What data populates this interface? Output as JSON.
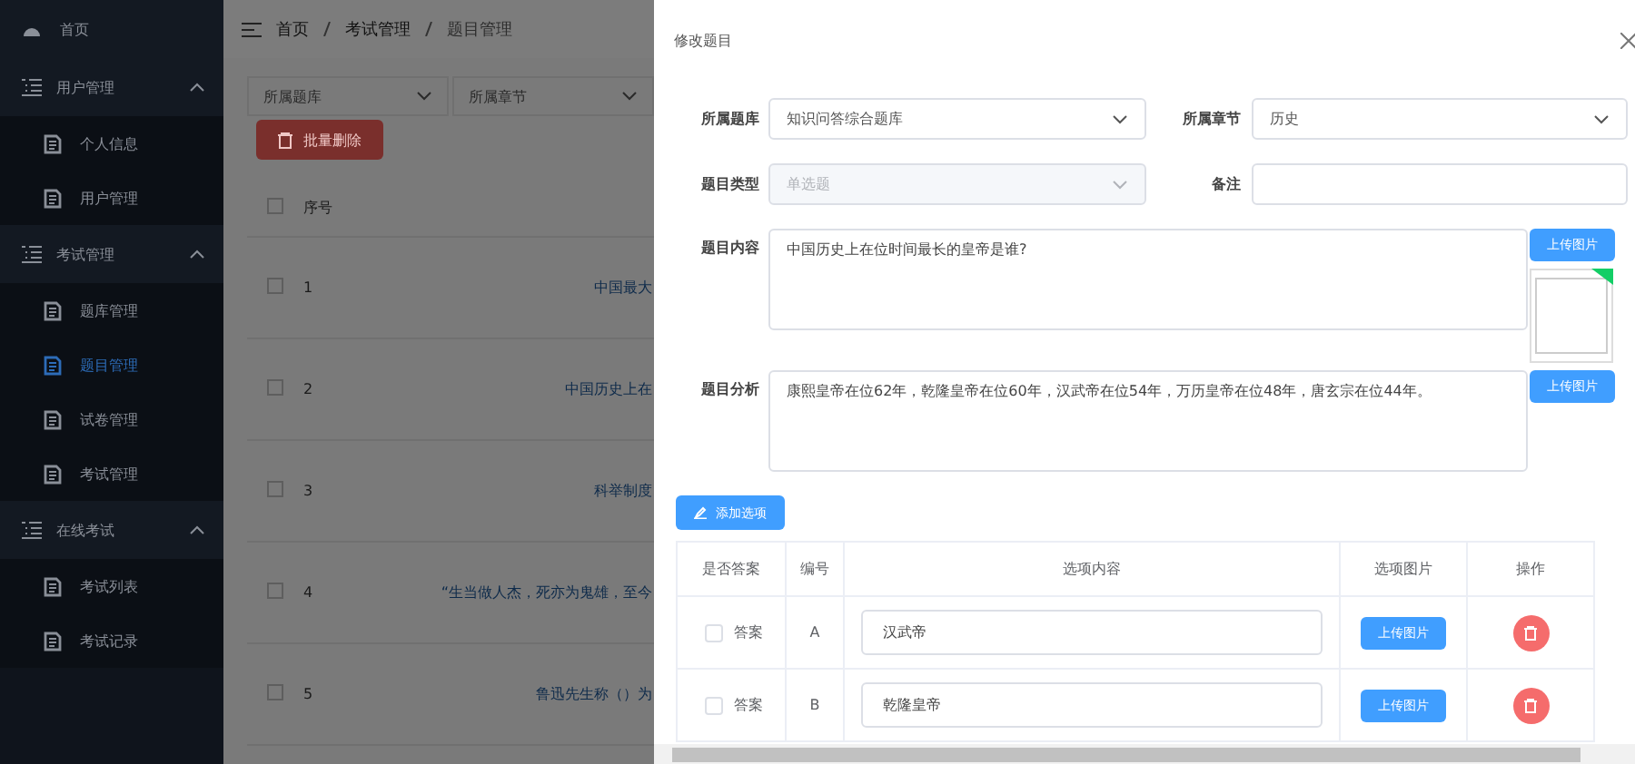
{
  "sidebar": {
    "items": [
      {
        "kind": "link",
        "label": "首页",
        "selected": false
      },
      {
        "kind": "group",
        "label": "用户管理",
        "expanded": true,
        "children": [
          {
            "label": "个人信息",
            "selected": false
          },
          {
            "label": "用户管理",
            "selected": false
          }
        ]
      },
      {
        "kind": "group",
        "label": "考试管理",
        "expanded": true,
        "children": [
          {
            "label": "题库管理",
            "selected": false
          },
          {
            "label": "题目管理",
            "selected": true
          },
          {
            "label": "试卷管理",
            "selected": false
          },
          {
            "label": "考试管理",
            "selected": false
          }
        ]
      },
      {
        "kind": "group",
        "label": "在线考试",
        "expanded": true,
        "children": [
          {
            "label": "考试列表",
            "selected": false
          },
          {
            "label": "考试记录",
            "selected": false
          }
        ]
      }
    ]
  },
  "breadcrumb": [
    "首页",
    "考试管理",
    "题目管理"
  ],
  "filters": [
    {
      "placeholder": "所属题库"
    },
    {
      "placeholder": "所属章节"
    }
  ],
  "batch_delete_button": "批量删除",
  "table": {
    "all_checked": false,
    "columns": [
      "序号"
    ],
    "rows": [
      {
        "checked": false,
        "index": "1",
        "question": "中国最大"
      },
      {
        "checked": false,
        "index": "2",
        "question": "中国历史上在"
      },
      {
        "checked": false,
        "index": "3",
        "question": "科举制度"
      },
      {
        "checked": false,
        "index": "4",
        "question": "“生当做人杰，死亦为鬼雄，至今"
      },
      {
        "checked": false,
        "index": "5",
        "question": "鲁迅先生称（）为"
      }
    ]
  },
  "dialog": {
    "title": "修改题目",
    "bank": {
      "label": "所属题库",
      "value": "知识问答综合题库"
    },
    "chapter": {
      "label": "所属章节",
      "value": "历史"
    },
    "type": {
      "label": "题目类型",
      "value": "单选题",
      "disabled": true
    },
    "remark": {
      "label": "备注"
    },
    "content": {
      "label": "题目内容",
      "value": "中国历史上在位时间最长的皇帝是谁?",
      "upload_button": "上传图片"
    },
    "analysis": {
      "label": "题目分析",
      "value": "康熙皇帝在位62年，乾隆皇帝在位60年，汉武帝在位54年，万历皇帝在位48年，唐玄宗在位44年。",
      "upload_button": "上传图片"
    },
    "add_option_button": "添加选项",
    "options": {
      "columns": [
        "是否答案",
        "编号",
        "选项内容",
        "选项图片",
        "操作"
      ],
      "rows": [
        {
          "answer_label": "答案",
          "checked": false,
          "letter": "A",
          "content": "汉武帝",
          "upload_button": "上传图片"
        },
        {
          "answer_label": "答案",
          "checked": false,
          "letter": "B",
          "content": "乾隆皇帝",
          "upload_button": "上传图片"
        }
      ]
    }
  }
}
